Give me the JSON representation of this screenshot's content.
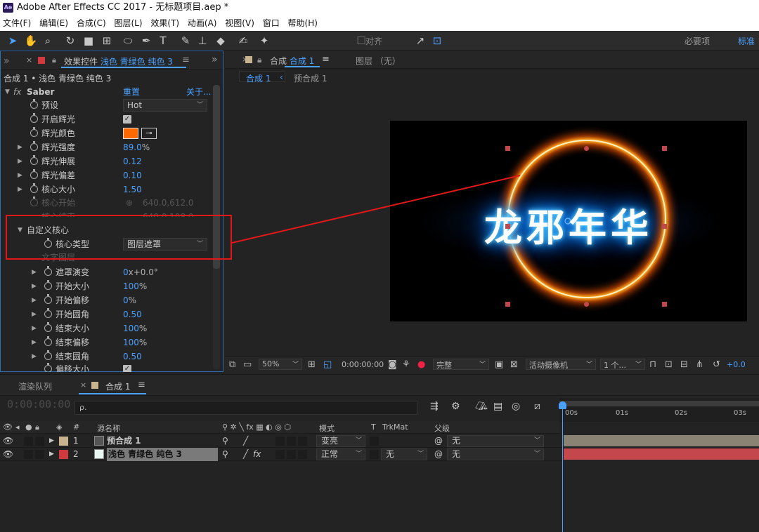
{
  "window": {
    "title": "Adobe After Effects CC 2017 - 无标题项目.aep *",
    "logo_text": "Ae"
  },
  "menu": [
    "文件(F)",
    "编辑(E)",
    "合成(C)",
    "图层(L)",
    "效果(T)",
    "动画(A)",
    "视图(V)",
    "窗口",
    "帮助(H)"
  ],
  "toolbar": {
    "snap_label": "对齐",
    "workspace_essential": "必要项",
    "workspace_standard": "标准"
  },
  "effect_controls": {
    "tab_prefix": "效果控件",
    "tab_layer": "浅色 青绿色 纯色 3",
    "breadcrumb": "合成 1 • 浅色 青绿色 纯色 3",
    "effect_name": "Saber",
    "reset": "重置",
    "about": "关于...",
    "rows": {
      "preset": {
        "label": "预设",
        "value": "Hot"
      },
      "enable_glow": {
        "label": "开启辉光"
      },
      "glow_color": {
        "label": "辉光颜色",
        "color": "#ff6a00"
      },
      "glow_intensity": {
        "label": "辉光强度",
        "value": "89.0",
        "unit": "%"
      },
      "glow_spread": {
        "label": "辉光伸展",
        "value": "0.12"
      },
      "glow_bias": {
        "label": "辉光偏差",
        "value": "0.10"
      },
      "core_size": {
        "label": "核心大小",
        "value": "1.50"
      },
      "core_start": {
        "label": "核心开始",
        "value": "640.0,612.0"
      },
      "core_end": {
        "label": "核心结束",
        "value": "640.0,108.0"
      },
      "custom_core": {
        "label": "自定义核心"
      },
      "core_type": {
        "label": "核心类型",
        "value": "图层遮罩"
      },
      "text_layer": {
        "label": "文字图层"
      },
      "mask_evolution": {
        "label": "遮罩演变",
        "value": "0",
        "unit": "x+0.0°"
      },
      "start_size": {
        "label": "开始大小",
        "value": "100",
        "unit": "%"
      },
      "start_offset": {
        "label": "开始偏移",
        "value": "0",
        "unit": "%"
      },
      "start_round": {
        "label": "开始圆角",
        "value": "0.50"
      },
      "end_size": {
        "label": "结束大小",
        "value": "100",
        "unit": "%"
      },
      "end_offset": {
        "label": "结束偏移",
        "value": "100",
        "unit": "%"
      },
      "end_round": {
        "label": "结束圆角",
        "value": "0.50"
      },
      "offset_size": {
        "label": "偏移大小"
      }
    }
  },
  "composition": {
    "tab_prefix": "合成",
    "tab_name": "合成 1",
    "layer_tab": "图层 （无）",
    "sub_active": "合成 1",
    "sub_other": "预合成 1",
    "viewer_text": "龙邪年华",
    "controls": {
      "zoom": "50%",
      "timecode": "0:00:00:00",
      "quality": "完整",
      "camera": "活动摄像机",
      "views": "1 个...",
      "exposure": "+0.0"
    }
  },
  "timeline": {
    "render_queue": "渲染队列",
    "comp_tab": "合成 1",
    "timecode": "0:00:00:00",
    "search_placeholder": "ρ.",
    "ruler": [
      "00s",
      "01s",
      "02s",
      "03s"
    ],
    "headers": {
      "hash": "#",
      "source_name": "源名称",
      "mode": "模式",
      "t": "T",
      "trkmat": "TrkMat",
      "parent": "父级"
    },
    "layers": [
      {
        "num": "1",
        "name": "预合成 1",
        "mode": "变亮",
        "trkmat": "",
        "parent": "无",
        "label_color": "#c7b38e",
        "bar_color": "#8a8272"
      },
      {
        "num": "2",
        "name": "浅色 青绿色 纯色 3",
        "mode": "正常",
        "trkmat": "无",
        "parent": "无",
        "label_color": "#d0393d",
        "bar_color": "#c4474d"
      }
    ]
  }
}
